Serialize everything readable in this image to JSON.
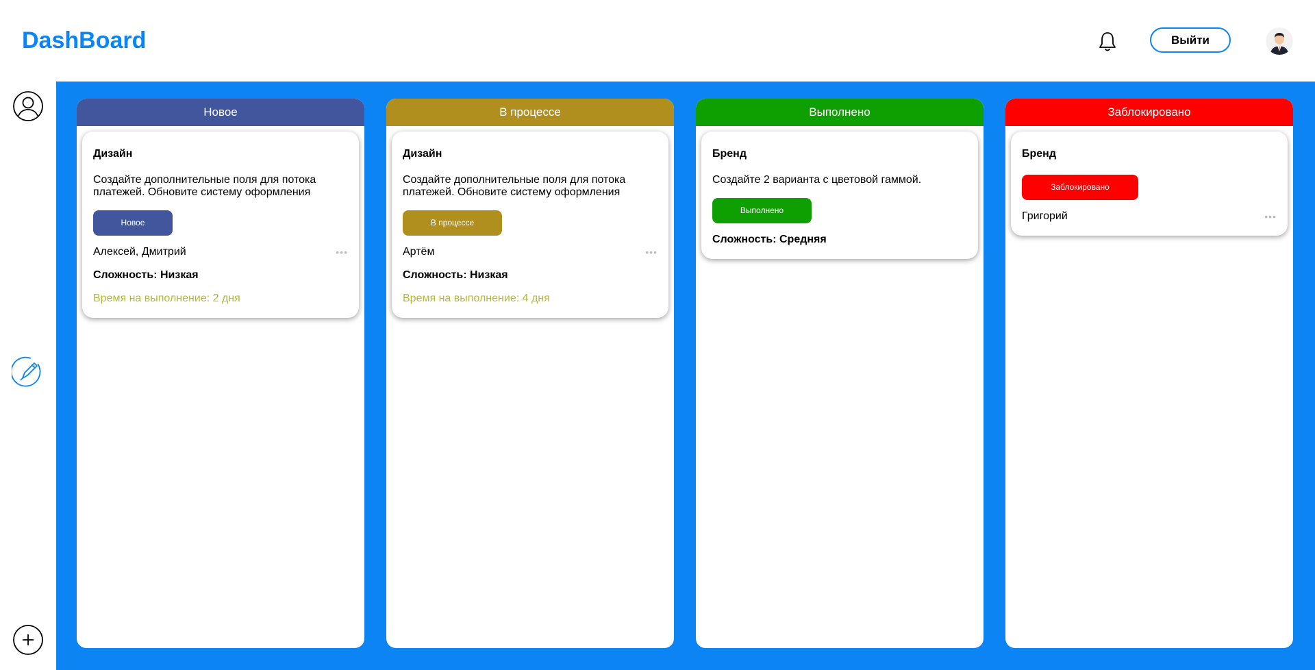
{
  "app": {
    "title": "DashBoard",
    "logout_label": "Выйти"
  },
  "colors": {
    "accent": "#0c84f4",
    "new": "#42569e",
    "in_progress": "#b08f1f",
    "done": "#0e9f00",
    "blocked": "#ff0000",
    "time_text": "#b5b83a"
  },
  "icons": {
    "bell": "bell-icon",
    "avatar": "user-avatar",
    "profile": "user-circle-icon",
    "edit": "pen-circle-icon",
    "add": "plus-circle-icon",
    "more": "ellipsis-icon"
  },
  "columns": [
    {
      "title": "Новое",
      "cards": [
        {
          "title": "Дизайн",
          "description": "Создайте дополнительные поля для потока платежей. Обновите систему оформления",
          "status": "Новое",
          "assignees": "Алексей, Дмитрий",
          "more": "•••",
          "difficulty": "Сложность: Низкая",
          "time": "Время на выполнение: 2 дня"
        }
      ]
    },
    {
      "title": "В процессе",
      "cards": [
        {
          "title": "Дизайн",
          "description": "Создайте дополнительные поля для потока платежей. Обновите систему оформления",
          "status": "В процессе",
          "assignees": "Артём",
          "more": "•••",
          "difficulty": "Сложность: Низкая",
          "time": "Время на выполнение: 4 дня"
        }
      ]
    },
    {
      "title": "Выполнено",
      "cards": [
        {
          "title": "Бренд",
          "description": "Создайте 2 варианта с цветовой гаммой.",
          "status": "Выполнено",
          "difficulty": "Сложность: Средняя"
        }
      ]
    },
    {
      "title": "Заблокировано",
      "cards": [
        {
          "title": "Бренд",
          "status": "Заблокировано",
          "assignees": "Григорий",
          "more": "•••"
        }
      ]
    }
  ]
}
